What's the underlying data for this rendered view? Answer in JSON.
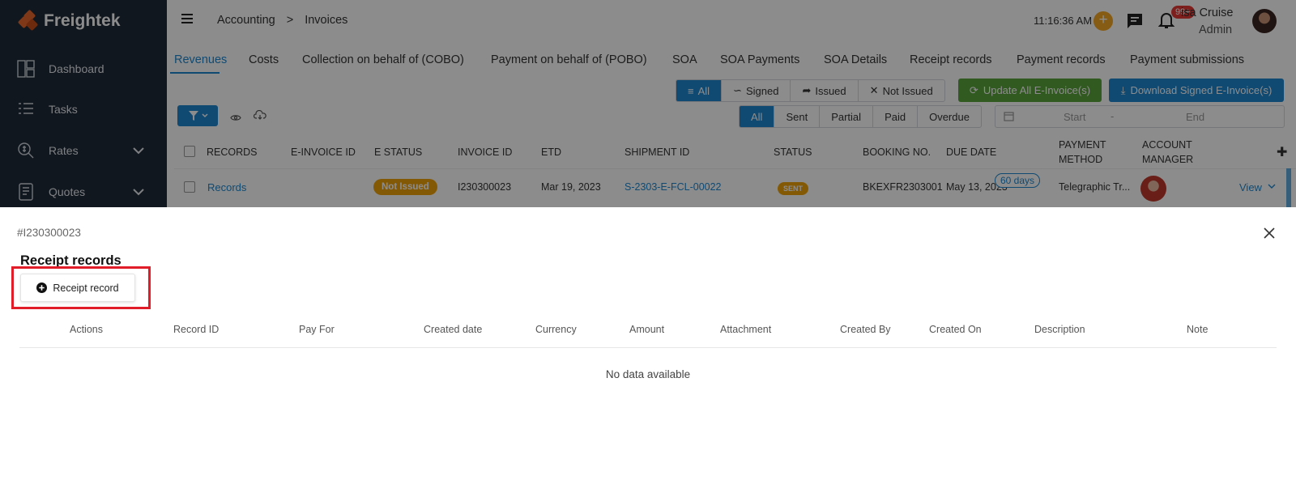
{
  "app": {
    "brand": "Freightek",
    "nav": [
      {
        "label": "Dashboard",
        "icon": "dashboard-icon"
      },
      {
        "label": "Tasks",
        "icon": "tasks-icon"
      },
      {
        "label": "Rates",
        "icon": "rates-icon",
        "expandable": true
      },
      {
        "label": "Quotes",
        "icon": "quotes-icon",
        "expandable": true
      }
    ]
  },
  "header": {
    "breadcrumb": [
      "Accounting",
      ">",
      "Invoices"
    ],
    "clock": "11:16:36 AM",
    "notifications_badge": "99+",
    "user_name": "isa Cruise",
    "user_role": "Admin"
  },
  "tabs": [
    "Revenues",
    "Costs",
    "Collection on behalf of (COBO)",
    "Payment on behalf of (POBO)",
    "SOA",
    "SOA Payments",
    "SOA Details",
    "Receipt records",
    "Payment records",
    "Payment submissions"
  ],
  "active_tab": "Revenues",
  "einvoice_filter": [
    "All",
    "Signed",
    "Issued",
    "Not Issued"
  ],
  "status_filter": [
    "All",
    "Sent",
    "Partial",
    "Paid",
    "Overdue"
  ],
  "actions": {
    "update_all": "Update All E-Invoice(s)",
    "download_signed": "Download Signed E-Invoice(s)"
  },
  "date_range": {
    "start_placeholder": "Start",
    "separator": "-",
    "end_placeholder": "End"
  },
  "grid": {
    "columns": [
      "RECORDS",
      "E-INVOICE ID",
      "E STATUS",
      "INVOICE ID",
      "ETD",
      "SHIPMENT ID",
      "STATUS",
      "BOOKING NO.",
      "DUE DATE",
      "PAYMENT",
      "METHOD",
      "ACCOUNT",
      "MANAGER"
    ],
    "row": {
      "records": "Records",
      "e_status": "Not Issued",
      "invoice_id": "I230300023",
      "etd": "Mar 19, 2023",
      "shipment_id": "S-2303-E-FCL-00022",
      "status": "SENT",
      "booking_no": "BKEXFR2303001",
      "due_date": "May 13, 2023",
      "due_badge": "60 days",
      "payment_method": "Telegraphic Tr...",
      "view": "View"
    }
  },
  "panel": {
    "invoice_ref": "#I230300023",
    "title": "Receipt records",
    "add_button": "Receipt record",
    "columns": [
      "Actions",
      "Record ID",
      "Pay For",
      "Created date",
      "Currency",
      "Amount",
      "Attachment",
      "Created By",
      "Created On",
      "Description",
      "Note"
    ],
    "empty": "No data available"
  },
  "colors": {
    "sidebar": "#1e2a38",
    "accent": "#1e88d0",
    "green": "#5aa43b",
    "orange": "#f0a30a",
    "highlight": "#e11d2a"
  }
}
